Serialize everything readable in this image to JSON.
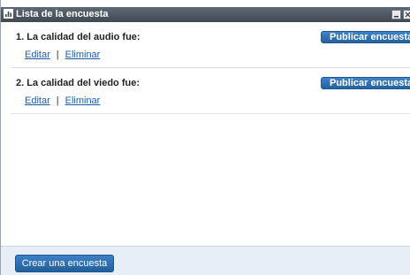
{
  "window": {
    "title": "Lista de la encuesta",
    "icon": "bar-chart-icon",
    "controls": [
      "minimize-icon",
      "close-icon"
    ]
  },
  "questions": [
    {
      "text": "1. La calidad del audio fue:",
      "edit_label": "Editar",
      "separator": "|",
      "delete_label": "Eliminar",
      "publish_label": "Publicar encuesta"
    },
    {
      "text": "2. La calidad del viedo fue:",
      "edit_label": "Editar",
      "separator": "|",
      "delete_label": "Eliminar",
      "publish_label": "Publicar encuesta"
    }
  ],
  "footer": {
    "create_label": "Crear una encuesta"
  },
  "colors": {
    "titlebar": "#4f5964",
    "link": "#1f5fa8",
    "button": "#2f72b6",
    "footer": "#e7eef7"
  }
}
